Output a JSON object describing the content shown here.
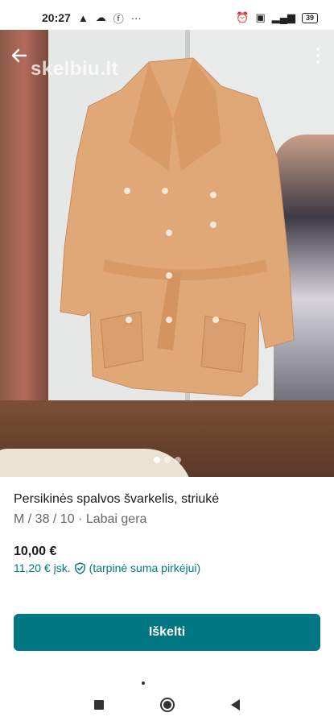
{
  "status_bar": {
    "time": "20:27",
    "left_icons": [
      "warning-icon",
      "cloud-icon",
      "facebook-icon",
      "more-dots-icon"
    ],
    "right_icons": [
      "alarm-icon",
      "volte-icon",
      "signal-5g-icon"
    ],
    "battery": "39"
  },
  "photo": {
    "watermark": "skelbiu.lt",
    "carousel_count": 3,
    "carousel_active": 0
  },
  "listing": {
    "title": "Persikinės spalvos švarkelis, striukė",
    "details": "M / 38 / 10 · Labai gera",
    "price": "10,00 €",
    "price_incl": "11,20 €",
    "price_incl_label": "įsk.",
    "price_incl_note": "(tarpinė suma pirkėjui)"
  },
  "actions": {
    "primary_label": "Iškelti"
  },
  "colors": {
    "accent": "#007782",
    "coat": "#e0a877"
  }
}
